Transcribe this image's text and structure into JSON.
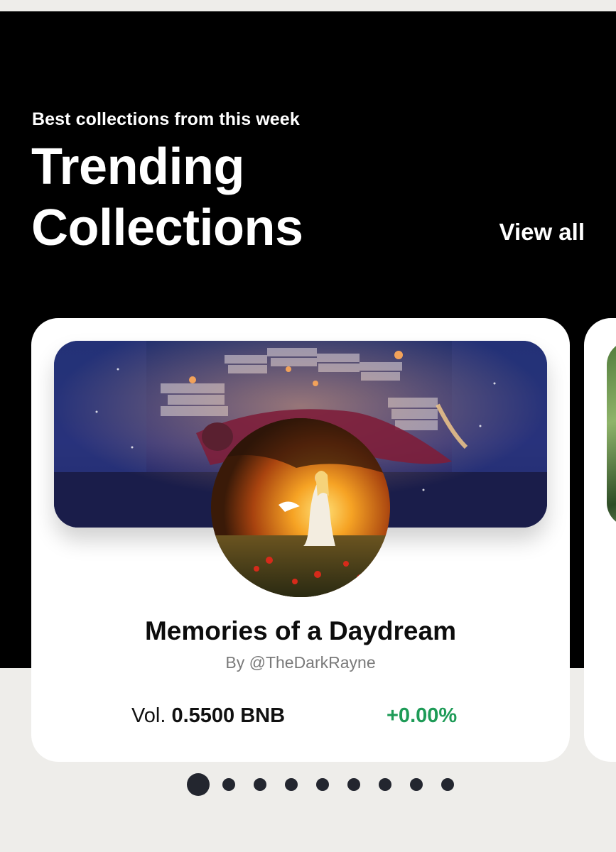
{
  "header": {
    "subtitle": "Best collections from this week",
    "title_line1": "Trending",
    "title_line2": "Collections",
    "view_all_label": "View all"
  },
  "collection_card": {
    "name": "Memories of a Daydream",
    "creator": "By @TheDarkRayne",
    "volume_label": "Vol.",
    "volume_value": "0.5500 BNB",
    "change": "+0.00%"
  },
  "carousel": {
    "total_slides": 9,
    "active_index": 0
  },
  "colors": {
    "hero_background": "#000000",
    "page_background": "#eeedea",
    "card_background": "#ffffff",
    "positive_change": "#1e9b57",
    "pagination_dot": "#23262f"
  }
}
